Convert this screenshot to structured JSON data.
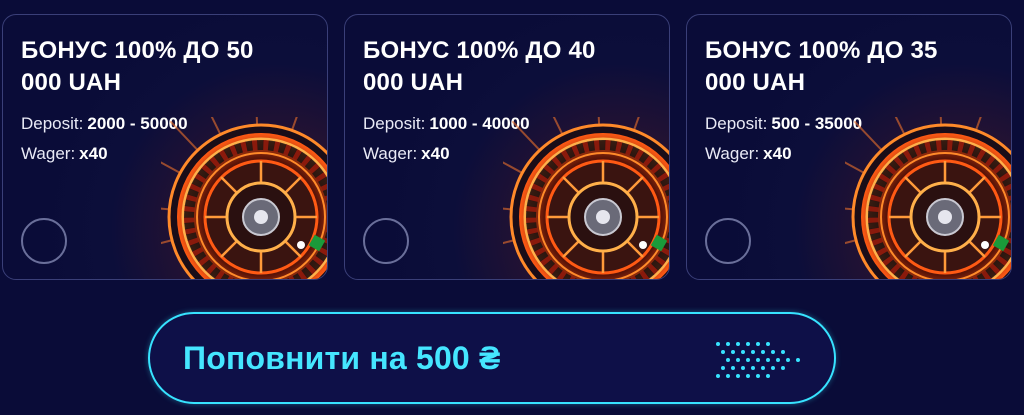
{
  "bonuses": [
    {
      "title": "БОНУС 100% ДО 50 000 UAH",
      "deposit_label": "Deposit:",
      "deposit_value": "2000 - 50000",
      "wager_label": "Wager:",
      "wager_value": "x40"
    },
    {
      "title": "БОНУС 100% ДО 40 000 UAH",
      "deposit_label": "Deposit:",
      "deposit_value": "1000 - 40000",
      "wager_label": "Wager:",
      "wager_value": "x40"
    },
    {
      "title": "БОНУС 100% ДО 35 000 UAH",
      "deposit_label": "Deposit:",
      "deposit_value": "500 - 35000",
      "wager_label": "Wager:",
      "wager_value": "x40"
    }
  ],
  "deposit_button": {
    "label": "Поповнити на 500 ₴",
    "icon": "arrow-chevrons-icon"
  },
  "colors": {
    "background": "#0a0c38",
    "accent": "#37e3ff",
    "roulette_glow": "#ff6a1a"
  }
}
